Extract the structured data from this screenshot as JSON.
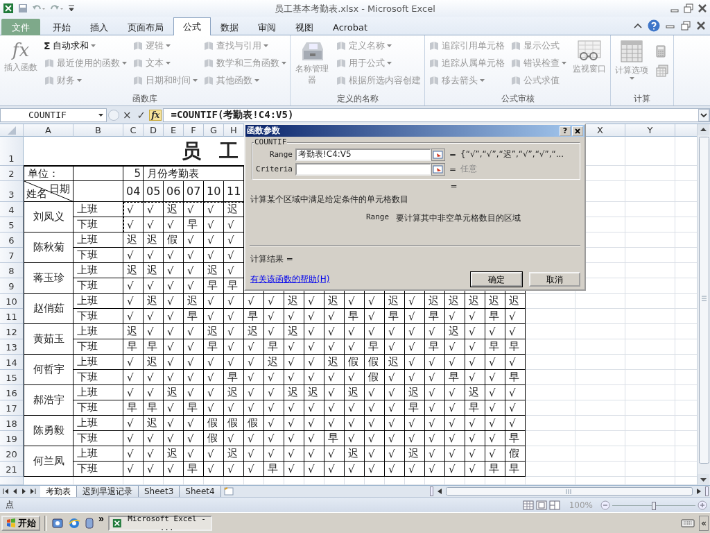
{
  "window": {
    "title": "员工基本考勤表.xlsx - Microsoft Excel"
  },
  "ribbon_tabs": [
    {
      "label": "文件",
      "kind": "file",
      "selected": false
    },
    {
      "label": "开始",
      "kind": "tab",
      "selected": false
    },
    {
      "label": "插入",
      "kind": "tab",
      "selected": false
    },
    {
      "label": "页面布局",
      "kind": "tab",
      "selected": false
    },
    {
      "label": "公式",
      "kind": "tab",
      "selected": true
    },
    {
      "label": "数据",
      "kind": "tab",
      "selected": false
    },
    {
      "label": "审阅",
      "kind": "tab",
      "selected": false
    },
    {
      "label": "视图",
      "kind": "tab",
      "selected": false
    },
    {
      "label": "Acrobat",
      "kind": "tab",
      "selected": false
    }
  ],
  "ribbon_groups": [
    {
      "label": "函数库",
      "items": [
        {
          "kind": "large",
          "label": "插入函数",
          "glyph": "fx",
          "disabled": true
        },
        {
          "kind": "column",
          "items": [
            {
              "label": "自动求和",
              "glyph": "Σ",
              "dropdown": true,
              "disabled": false
            },
            {
              "label": "最近使用的函数",
              "dropdown": true,
              "disabled": true
            },
            {
              "label": "财务",
              "dropdown": true,
              "disabled": true
            }
          ]
        },
        {
          "kind": "column",
          "items": [
            {
              "label": "逻辑",
              "dropdown": true,
              "disabled": true
            },
            {
              "label": "文本",
              "dropdown": true,
              "disabled": true
            },
            {
              "label": "日期和时间",
              "dropdown": true,
              "disabled": true
            }
          ]
        },
        {
          "kind": "column",
          "items": [
            {
              "label": "查找与引用",
              "dropdown": true,
              "disabled": true
            },
            {
              "label": "数学和三角函数",
              "dropdown": true,
              "disabled": true
            },
            {
              "label": "其他函数",
              "dropdown": true,
              "disabled": true
            }
          ]
        }
      ]
    },
    {
      "label": "定义的名称",
      "items": [
        {
          "kind": "large",
          "label": "名称管理器",
          "disabled": true
        },
        {
          "kind": "column",
          "items": [
            {
              "label": "定义名称",
              "dropdown": true,
              "disabled": true
            },
            {
              "label": "用于公式",
              "dropdown": true,
              "disabled": true
            },
            {
              "label": "根据所选内容创建",
              "dropdown": false,
              "disabled": true
            }
          ]
        }
      ]
    },
    {
      "label": "公式审核",
      "items": [
        {
          "kind": "column",
          "items": [
            {
              "label": "追踪引用单元格",
              "dropdown": false,
              "disabled": true
            },
            {
              "label": "追踪从属单元格",
              "dropdown": false,
              "disabled": true
            },
            {
              "label": "移去箭头",
              "dropdown": true,
              "disabled": true
            }
          ]
        },
        {
          "kind": "column",
          "items": [
            {
              "label": "显示公式",
              "dropdown": false,
              "disabled": true
            },
            {
              "label": "错误检查",
              "dropdown": true,
              "disabled": true
            },
            {
              "label": "公式求值",
              "dropdown": false,
              "disabled": true
            }
          ]
        },
        {
          "kind": "large",
          "label": "监视窗口",
          "disabled": true
        }
      ]
    },
    {
      "label": "计算",
      "items": [
        {
          "kind": "large",
          "label": "计算选项",
          "dropdown": true,
          "disabled": true
        },
        {
          "kind": "icons"
        }
      ]
    }
  ],
  "formula_bar": {
    "name_box": "COUNTIF",
    "cancel": "×",
    "enter": "✓",
    "insert_function": "fx",
    "formula": "=COUNTIF(考勤表!C4:V5)"
  },
  "sheet": {
    "column_headers": [
      "A",
      "B",
      "C",
      "D",
      "E",
      "F",
      "G",
      "H"
    ],
    "column_headers_right": [
      "X",
      "Y"
    ],
    "row_headers": [
      "1",
      "2",
      "3",
      "4",
      "5",
      "6",
      "7",
      "8",
      "9",
      "10",
      "11",
      "12",
      "13",
      "14",
      "15",
      "16",
      "17",
      "18",
      "19",
      "20",
      "21"
    ],
    "title": "员 工",
    "unit_label": "单位：",
    "month": "5",
    "sheet_title": "月份考勤表",
    "date_label": "日期",
    "name_label": "姓名",
    "days": [
      "04",
      "05",
      "06",
      "07",
      "10",
      "11"
    ],
    "employees": [
      {
        "name": "刘凤义",
        "referenced": true,
        "shifts": [
          {
            "label": "上班",
            "values": [
              "√",
              "√",
              "迟",
              "√",
              "√",
              "迟"
            ]
          },
          {
            "label": "下班",
            "values": [
              "√",
              "√",
              "√",
              "早",
              "√",
              "√"
            ]
          }
        ]
      },
      {
        "name": "陈秋菊",
        "referenced": false,
        "shifts": [
          {
            "label": "上班",
            "values": [
              "迟",
              "迟",
              "假",
              "√",
              "√",
              "√"
            ]
          },
          {
            "label": "下班",
            "values": [
              "√",
              "√",
              "√",
              "√",
              "√",
              "√"
            ]
          }
        ]
      },
      {
        "name": "蒋玉珍",
        "referenced": false,
        "shifts": [
          {
            "label": "上班",
            "values": [
              "迟",
              "迟",
              "√",
              "√",
              "迟",
              "√"
            ]
          },
          {
            "label": "下班",
            "values": [
              "√",
              "√",
              "√",
              "√",
              "早",
              "早"
            ]
          }
        ]
      },
      {
        "name": "赵俏茹",
        "referenced": false,
        "shifts": [
          {
            "label": "上班",
            "values": [
              "√",
              "迟",
              "√",
              "迟",
              "√",
              "√",
              "√",
              "√",
              "迟",
              "√",
              "迟",
              "√",
              "√",
              "迟",
              "√",
              "迟",
              "迟",
              "迟",
              "迟",
              "迟"
            ]
          },
          {
            "label": "下班",
            "values": [
              "√",
              "√",
              "√",
              "早",
              "√",
              "√",
              "早",
              "√",
              "√",
              "√",
              "√",
              "早",
              "√",
              "早",
              "√",
              "早",
              "√",
              "√",
              "早",
              "√"
            ]
          }
        ]
      },
      {
        "name": "黄茹玉",
        "referenced": false,
        "shifts": [
          {
            "label": "上班",
            "values": [
              "迟",
              "√",
              "√",
              "√",
              "迟",
              "√",
              "迟",
              "√",
              "迟",
              "√",
              "√",
              "√",
              "√",
              "√",
              "√",
              "√",
              "迟",
              "√",
              "√",
              "√"
            ]
          },
          {
            "label": "下班",
            "values": [
              "早",
              "早",
              "√",
              "√",
              "早",
              "√",
              "√",
              "早",
              "√",
              "√",
              "√",
              "√",
              "早",
              "√",
              "√",
              "早",
              "√",
              "√",
              "早",
              "早"
            ]
          }
        ]
      },
      {
        "name": "何哲宇",
        "referenced": false,
        "shifts": [
          {
            "label": "上班",
            "values": [
              "√",
              "迟",
              "√",
              "√",
              "√",
              "√",
              "√",
              "迟",
              "√",
              "√",
              "迟",
              "假",
              "假",
              "迟",
              "√",
              "√",
              "√",
              "√",
              "√",
              "√"
            ]
          },
          {
            "label": "下班",
            "values": [
              "√",
              "√",
              "√",
              "√",
              "√",
              "早",
              "√",
              "√",
              "√",
              "√",
              "√",
              "√",
              "假",
              "√",
              "√",
              "√",
              "早",
              "√",
              "√",
              "早"
            ]
          }
        ]
      },
      {
        "name": "郝浩宇",
        "referenced": false,
        "shifts": [
          {
            "label": "上班",
            "values": [
              "√",
              "√",
              "迟",
              "√",
              "√",
              "迟",
              "√",
              "√",
              "迟",
              "迟",
              "√",
              "迟",
              "√",
              "√",
              "迟",
              "√",
              "√",
              "迟",
              "√",
              "√"
            ]
          },
          {
            "label": "下班",
            "values": [
              "早",
              "早",
              "√",
              "早",
              "√",
              "√",
              "√",
              "√",
              "√",
              "√",
              "√",
              "√",
              "√",
              "√",
              "早",
              "√",
              "√",
              "早",
              "√",
              "√"
            ]
          }
        ]
      },
      {
        "name": "陈勇毅",
        "referenced": false,
        "shifts": [
          {
            "label": "上班",
            "values": [
              "√",
              "迟",
              "√",
              "√",
              "假",
              "假",
              "假",
              "√",
              "√",
              "√",
              "√",
              "√",
              "√",
              "√",
              "√",
              "√",
              "√",
              "√",
              "√",
              "√"
            ]
          },
          {
            "label": "下班",
            "values": [
              "√",
              "√",
              "√",
              "√",
              "假",
              "√",
              "√",
              "√",
              "√",
              "√",
              "早",
              "√",
              "√",
              "√",
              "√",
              "√",
              "√",
              "√",
              "√",
              "早"
            ]
          }
        ]
      },
      {
        "name": "何兰凤",
        "referenced": false,
        "shifts": [
          {
            "label": "上班",
            "values": [
              "√",
              "√",
              "迟",
              "√",
              "√",
              "迟",
              "√",
              "√",
              "√",
              "√",
              "√",
              "迟",
              "√",
              "√",
              "迟",
              "√",
              "√",
              "√",
              "√",
              "假"
            ]
          },
          {
            "label": "下班",
            "values": [
              "√",
              "√",
              "√",
              "早",
              "√",
              "√",
              "√",
              "早",
              "√",
              "√",
              "√",
              "√",
              "√",
              "√",
              "√",
              "√",
              "√",
              "√",
              "早",
              "早"
            ]
          }
        ]
      }
    ]
  },
  "dialog": {
    "title": "函数参数",
    "help": "?",
    "function": "COUNTIF",
    "arguments": [
      {
        "label": "Range",
        "value": "考勤表!C4:V5",
        "equals": "=",
        "result": "{“√”,“√”,“迟”,“√”,“√”,“...",
        "muted": false
      },
      {
        "label": "Criteria",
        "equals": "=",
        "result": "任意",
        "muted": true
      }
    ],
    "result_equals": "=",
    "description": "计算某个区域中满足给定条件的单元格数目",
    "argument_help": {
      "name": "Range",
      "text": "要计算其中非空单元格数目的区域"
    },
    "result_label": "计算结果 =",
    "help_link": "有关该函数的帮助(H)",
    "buttons": [
      {
        "label": "确定",
        "default": true
      },
      {
        "label": "取消",
        "default": false
      }
    ]
  },
  "sheet_tabs": [
    {
      "label": "考勤表",
      "selected": true
    },
    {
      "label": "迟到早退记录",
      "selected": false
    },
    {
      "label": "Sheet3",
      "selected": false
    },
    {
      "label": "Sheet4",
      "selected": false
    }
  ],
  "status_bar": {
    "mode": "点",
    "zoom": "100%",
    "zoom_slider": {
      "level": 0.5
    }
  },
  "taskbar": {
    "start": "开始",
    "more": "»",
    "task": "Microsoft Excel - ...",
    "tray_toggle": "«"
  }
}
